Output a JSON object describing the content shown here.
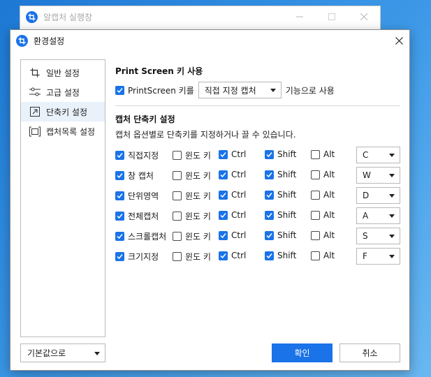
{
  "colors": {
    "accent": "#1a73e8",
    "active_bg": "#e9f1fb"
  },
  "bg_window": {
    "title": "알캡처 실행창",
    "controls": [
      "minimize-icon",
      "maximize-icon",
      "close-icon"
    ]
  },
  "dialog": {
    "title": "환경설정",
    "sidebar": {
      "items": [
        {
          "label": "일반 설정",
          "icon": "crop-icon",
          "active": false
        },
        {
          "label": "고급 설정",
          "icon": "sliders-icon",
          "active": false
        },
        {
          "label": "단축키 설정",
          "icon": "shortcut-arrow-icon",
          "active": true
        },
        {
          "label": "캡처목록 설정",
          "icon": "capture-list-icon",
          "active": false
        }
      ]
    },
    "default_select": "기본값으로",
    "printscreen": {
      "title": "Print Screen 키 사용",
      "checked": true,
      "checkbox_label": "PrintScreen 키를",
      "select_value": "직접 지정 캡처",
      "suffix": "기능으로 사용"
    },
    "shortcuts": {
      "title": "캡처 단축키 설정",
      "description": "캡처 옵션별로 단축키를 지정하거나 끌 수 있습니다.",
      "modifier_labels": {
        "win": "윈도 키",
        "ctrl": "Ctrl",
        "shift": "Shift",
        "alt": "Alt"
      },
      "rows": [
        {
          "name": "직접지정",
          "enabled": true,
          "win": false,
          "ctrl": true,
          "shift": true,
          "alt": false,
          "key": "C"
        },
        {
          "name": "창 캡처",
          "enabled": true,
          "win": false,
          "ctrl": true,
          "shift": true,
          "alt": false,
          "key": "W"
        },
        {
          "name": "단위영역",
          "enabled": true,
          "win": false,
          "ctrl": true,
          "shift": true,
          "alt": false,
          "key": "D"
        },
        {
          "name": "전체캡처",
          "enabled": true,
          "win": false,
          "ctrl": true,
          "shift": true,
          "alt": false,
          "key": "A"
        },
        {
          "name": "스크롤캡처",
          "enabled": true,
          "win": false,
          "ctrl": true,
          "shift": true,
          "alt": false,
          "key": "S"
        },
        {
          "name": "크기지정",
          "enabled": true,
          "win": false,
          "ctrl": true,
          "shift": true,
          "alt": false,
          "key": "F"
        }
      ]
    },
    "buttons": {
      "ok": "확인",
      "cancel": "취소"
    }
  }
}
